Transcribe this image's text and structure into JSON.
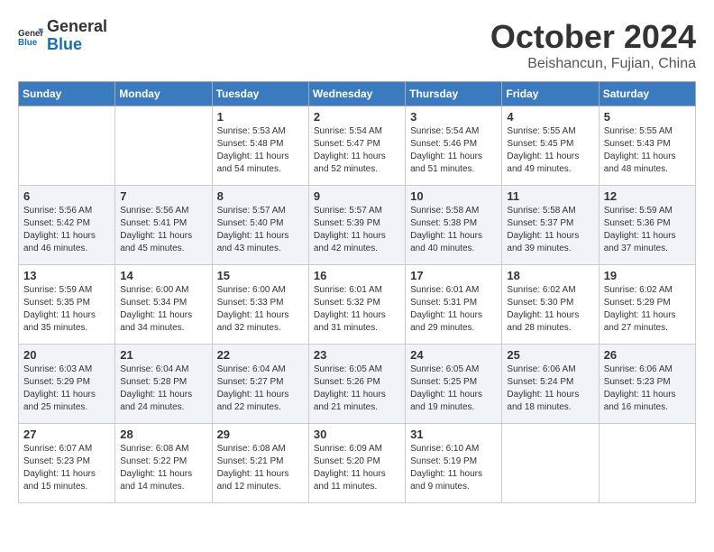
{
  "header": {
    "logo_general": "General",
    "logo_blue": "Blue",
    "title": "October 2024",
    "subtitle": "Beishancun, Fujian, China"
  },
  "days_of_week": [
    "Sunday",
    "Monday",
    "Tuesday",
    "Wednesday",
    "Thursday",
    "Friday",
    "Saturday"
  ],
  "weeks": [
    [
      {
        "day": "",
        "info": ""
      },
      {
        "day": "",
        "info": ""
      },
      {
        "day": "1",
        "info": "Sunrise: 5:53 AM\nSunset: 5:48 PM\nDaylight: 11 hours and 54 minutes."
      },
      {
        "day": "2",
        "info": "Sunrise: 5:54 AM\nSunset: 5:47 PM\nDaylight: 11 hours and 52 minutes."
      },
      {
        "day": "3",
        "info": "Sunrise: 5:54 AM\nSunset: 5:46 PM\nDaylight: 11 hours and 51 minutes."
      },
      {
        "day": "4",
        "info": "Sunrise: 5:55 AM\nSunset: 5:45 PM\nDaylight: 11 hours and 49 minutes."
      },
      {
        "day": "5",
        "info": "Sunrise: 5:55 AM\nSunset: 5:43 PM\nDaylight: 11 hours and 48 minutes."
      }
    ],
    [
      {
        "day": "6",
        "info": "Sunrise: 5:56 AM\nSunset: 5:42 PM\nDaylight: 11 hours and 46 minutes."
      },
      {
        "day": "7",
        "info": "Sunrise: 5:56 AM\nSunset: 5:41 PM\nDaylight: 11 hours and 45 minutes."
      },
      {
        "day": "8",
        "info": "Sunrise: 5:57 AM\nSunset: 5:40 PM\nDaylight: 11 hours and 43 minutes."
      },
      {
        "day": "9",
        "info": "Sunrise: 5:57 AM\nSunset: 5:39 PM\nDaylight: 11 hours and 42 minutes."
      },
      {
        "day": "10",
        "info": "Sunrise: 5:58 AM\nSunset: 5:38 PM\nDaylight: 11 hours and 40 minutes."
      },
      {
        "day": "11",
        "info": "Sunrise: 5:58 AM\nSunset: 5:37 PM\nDaylight: 11 hours and 39 minutes."
      },
      {
        "day": "12",
        "info": "Sunrise: 5:59 AM\nSunset: 5:36 PM\nDaylight: 11 hours and 37 minutes."
      }
    ],
    [
      {
        "day": "13",
        "info": "Sunrise: 5:59 AM\nSunset: 5:35 PM\nDaylight: 11 hours and 35 minutes."
      },
      {
        "day": "14",
        "info": "Sunrise: 6:00 AM\nSunset: 5:34 PM\nDaylight: 11 hours and 34 minutes."
      },
      {
        "day": "15",
        "info": "Sunrise: 6:00 AM\nSunset: 5:33 PM\nDaylight: 11 hours and 32 minutes."
      },
      {
        "day": "16",
        "info": "Sunrise: 6:01 AM\nSunset: 5:32 PM\nDaylight: 11 hours and 31 minutes."
      },
      {
        "day": "17",
        "info": "Sunrise: 6:01 AM\nSunset: 5:31 PM\nDaylight: 11 hours and 29 minutes."
      },
      {
        "day": "18",
        "info": "Sunrise: 6:02 AM\nSunset: 5:30 PM\nDaylight: 11 hours and 28 minutes."
      },
      {
        "day": "19",
        "info": "Sunrise: 6:02 AM\nSunset: 5:29 PM\nDaylight: 11 hours and 27 minutes."
      }
    ],
    [
      {
        "day": "20",
        "info": "Sunrise: 6:03 AM\nSunset: 5:29 PM\nDaylight: 11 hours and 25 minutes."
      },
      {
        "day": "21",
        "info": "Sunrise: 6:04 AM\nSunset: 5:28 PM\nDaylight: 11 hours and 24 minutes."
      },
      {
        "day": "22",
        "info": "Sunrise: 6:04 AM\nSunset: 5:27 PM\nDaylight: 11 hours and 22 minutes."
      },
      {
        "day": "23",
        "info": "Sunrise: 6:05 AM\nSunset: 5:26 PM\nDaylight: 11 hours and 21 minutes."
      },
      {
        "day": "24",
        "info": "Sunrise: 6:05 AM\nSunset: 5:25 PM\nDaylight: 11 hours and 19 minutes."
      },
      {
        "day": "25",
        "info": "Sunrise: 6:06 AM\nSunset: 5:24 PM\nDaylight: 11 hours and 18 minutes."
      },
      {
        "day": "26",
        "info": "Sunrise: 6:06 AM\nSunset: 5:23 PM\nDaylight: 11 hours and 16 minutes."
      }
    ],
    [
      {
        "day": "27",
        "info": "Sunrise: 6:07 AM\nSunset: 5:23 PM\nDaylight: 11 hours and 15 minutes."
      },
      {
        "day": "28",
        "info": "Sunrise: 6:08 AM\nSunset: 5:22 PM\nDaylight: 11 hours and 14 minutes."
      },
      {
        "day": "29",
        "info": "Sunrise: 6:08 AM\nSunset: 5:21 PM\nDaylight: 11 hours and 12 minutes."
      },
      {
        "day": "30",
        "info": "Sunrise: 6:09 AM\nSunset: 5:20 PM\nDaylight: 11 hours and 11 minutes."
      },
      {
        "day": "31",
        "info": "Sunrise: 6:10 AM\nSunset: 5:19 PM\nDaylight: 11 hours and 9 minutes."
      },
      {
        "day": "",
        "info": ""
      },
      {
        "day": "",
        "info": ""
      }
    ]
  ]
}
